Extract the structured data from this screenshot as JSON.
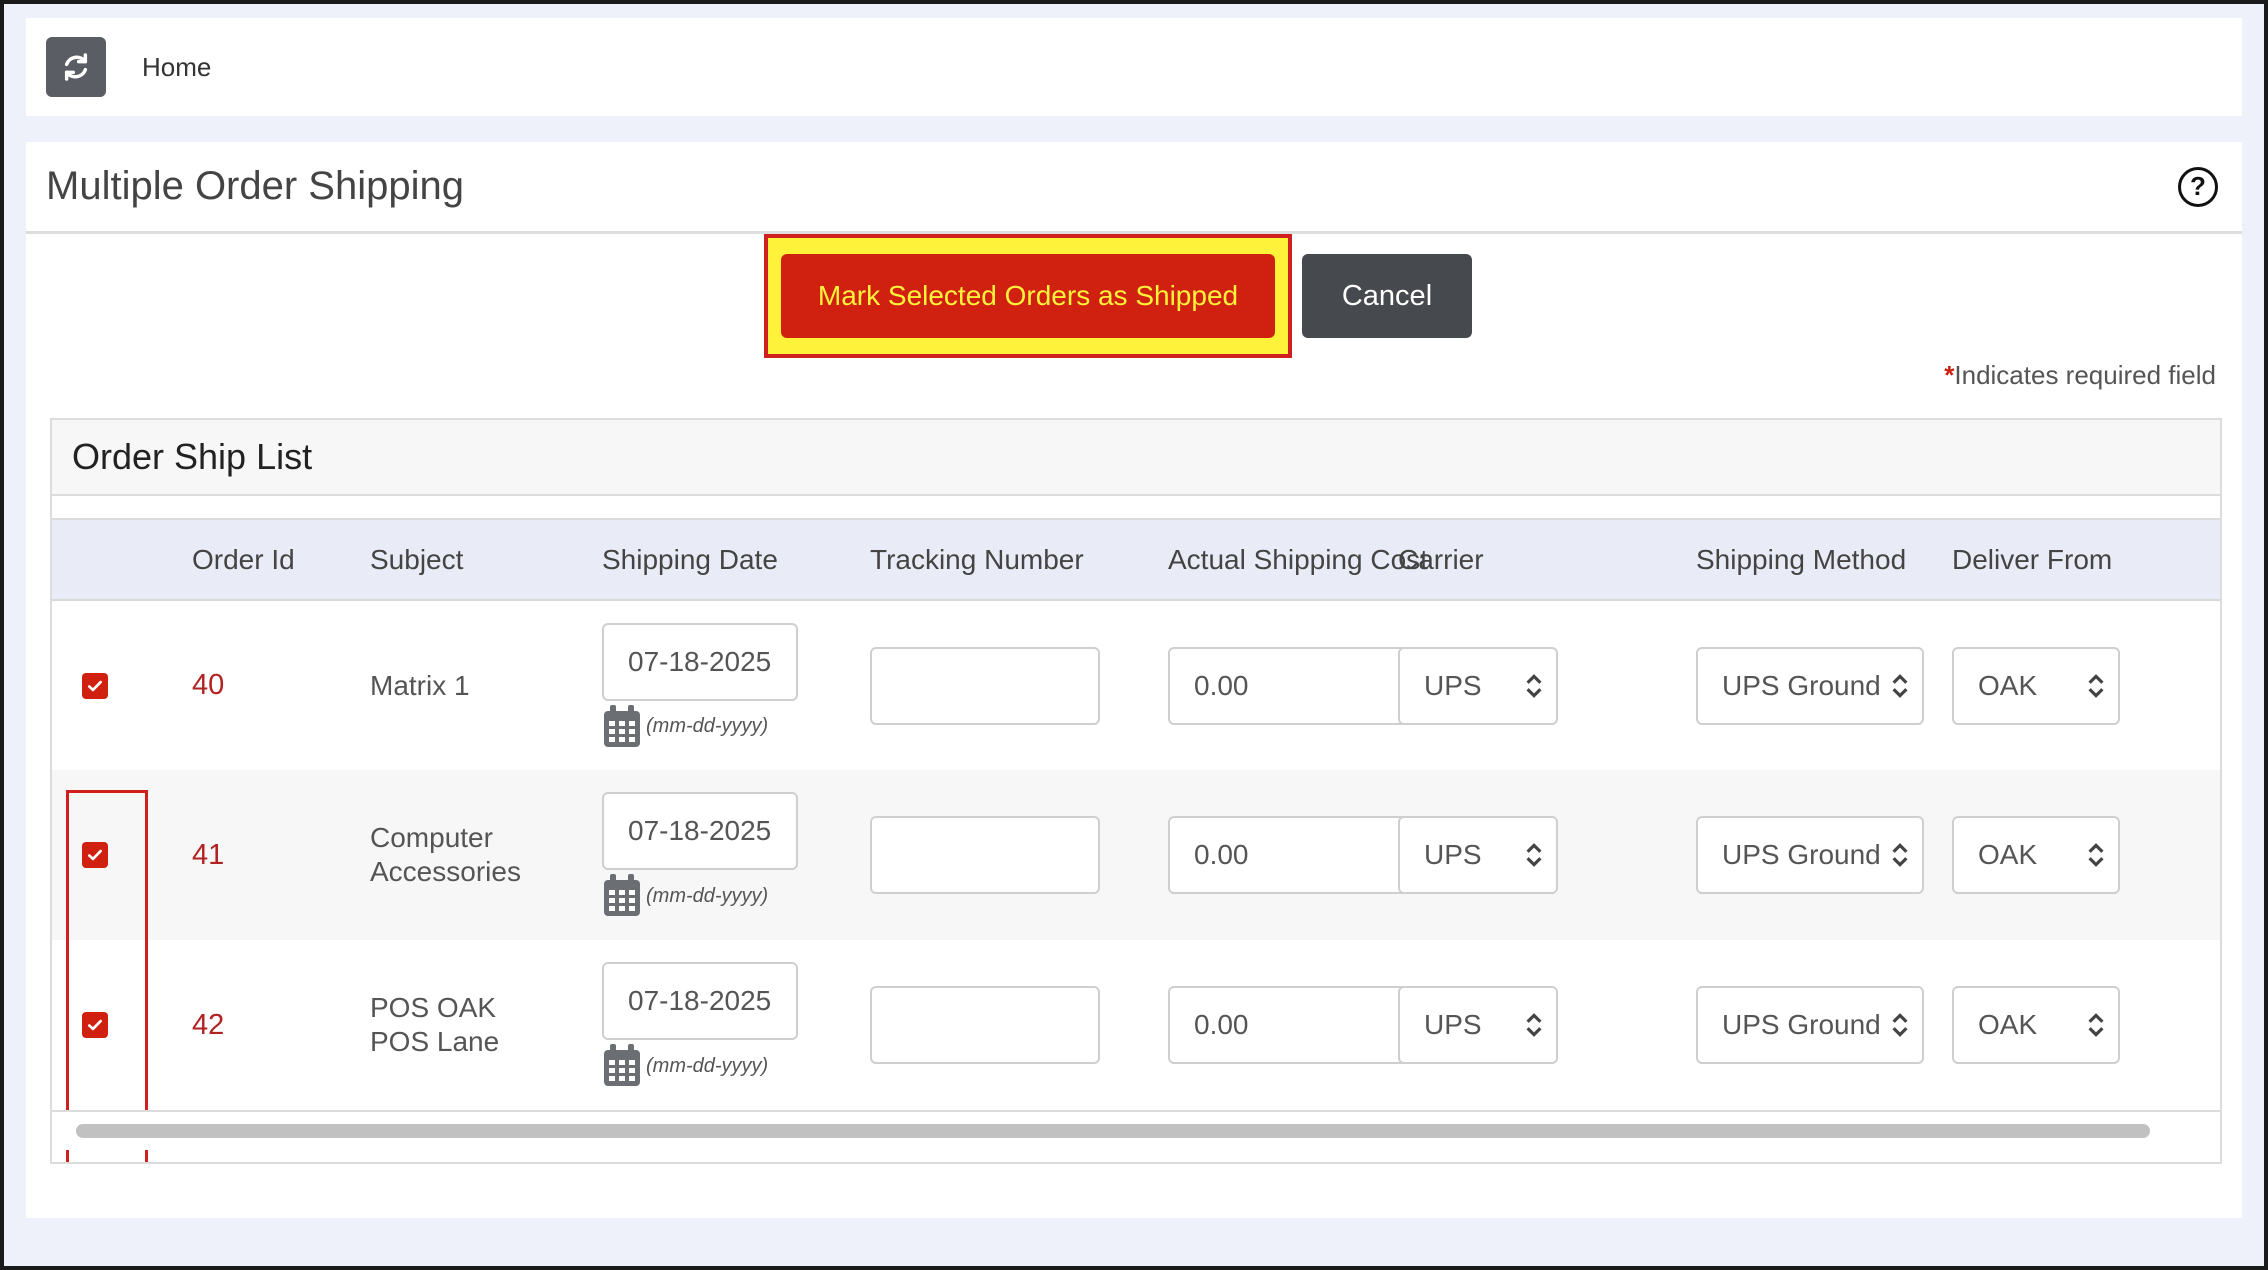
{
  "topbar": {
    "home_label": "Home"
  },
  "page": {
    "title": "Multiple Order Shipping",
    "help_label": "?",
    "mark_shipped_label": "Mark Selected Orders as Shipped",
    "cancel_label": "Cancel",
    "required_star": "*",
    "required_text": "Indicates required field"
  },
  "list": {
    "title": "Order Ship List",
    "columns": [
      "Order Id",
      "Subject",
      "Shipping Date",
      "Tracking Number",
      "Actual Shipping Cost",
      "Carrier",
      "Shipping Method",
      "Deliver From"
    ],
    "rows": [
      {
        "selected": true,
        "order_id": "40",
        "subject_line1": "Matrix 1",
        "subject_line2": "",
        "shipping_date": "07-18-2025",
        "date_format": "(mm-dd-yyyy)",
        "tracking_number": "",
        "shipping_cost": "0.00",
        "carrier": "UPS",
        "shipping_method": "UPS Ground",
        "deliver_from": "OAK"
      },
      {
        "selected": true,
        "order_id": "41",
        "subject_line1": "Computer",
        "subject_line2": "Accessories",
        "shipping_date": "07-18-2025",
        "date_format": "(mm-dd-yyyy)",
        "tracking_number": "",
        "shipping_cost": "0.00",
        "carrier": "UPS",
        "shipping_method": "UPS Ground",
        "deliver_from": "OAK"
      },
      {
        "selected": true,
        "order_id": "42",
        "subject_line1": "POS OAK",
        "subject_line2": "POS Lane",
        "shipping_date": "07-18-2025",
        "date_format": "(mm-dd-yyyy)",
        "tracking_number": "",
        "shipping_cost": "0.00",
        "carrier": "UPS",
        "shipping_method": "UPS Ground",
        "deliver_from": "OAK"
      }
    ]
  },
  "colors": {
    "accent_red": "#d0200f",
    "highlight_yellow": "#fff23a",
    "cancel_dark": "#46494e"
  }
}
